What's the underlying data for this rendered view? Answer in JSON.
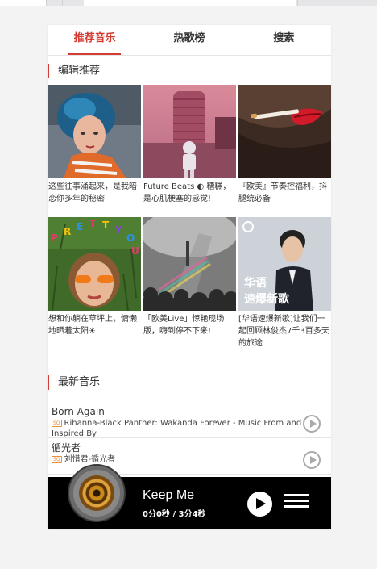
{
  "tabs": [
    {
      "label": "推荐音乐",
      "active": true
    },
    {
      "label": "热歌榜",
      "active": false
    },
    {
      "label": "搜索",
      "active": false
    }
  ],
  "editor_section": {
    "title": "编辑推荐"
  },
  "playlists": [
    {
      "title": "这些往事涌起来，是我暗恋你多年的秘密",
      "cover": "girl-painting-cover"
    },
    {
      "title": "Future Beats ◐ 糟糕，是心肌梗塞的感觉!",
      "cover": "tower-astronaut-cover"
    },
    {
      "title": "『欧美』节奏控福利，抖腿统必备",
      "cover": "red-lips-cover"
    },
    {
      "title": "想和你躺在草坪上，慵懒地晒着太阳☀",
      "cover": "girl-grass-cover"
    },
    {
      "title": "「欧美Live」惊艳现场版，嗨到停不下来!",
      "cover": "concert-crowd-cover"
    },
    {
      "title": "[华语速爆新歌]让我们一起回顾林俊杰7千3百多天的旅途",
      "cover": "singer-cover",
      "overlay": "华语\n速爆新歌"
    }
  ],
  "latest_section": {
    "title": "最新音乐"
  },
  "songs": [
    {
      "name": "Born Again",
      "badge": "SQ",
      "artist": "Rihanna-Black Panther: Wakanda Forever - Music From and Inspired By"
    },
    {
      "name": "循光者",
      "badge": "SQ",
      "artist": "刘惜君-循光者"
    }
  ],
  "player": {
    "title": "Keep Me",
    "time": "0分0秒 / 3分4秒"
  },
  "colors": {
    "accent": "#d43c33",
    "player_bg": "#000000",
    "badge": "#e98e3c"
  }
}
